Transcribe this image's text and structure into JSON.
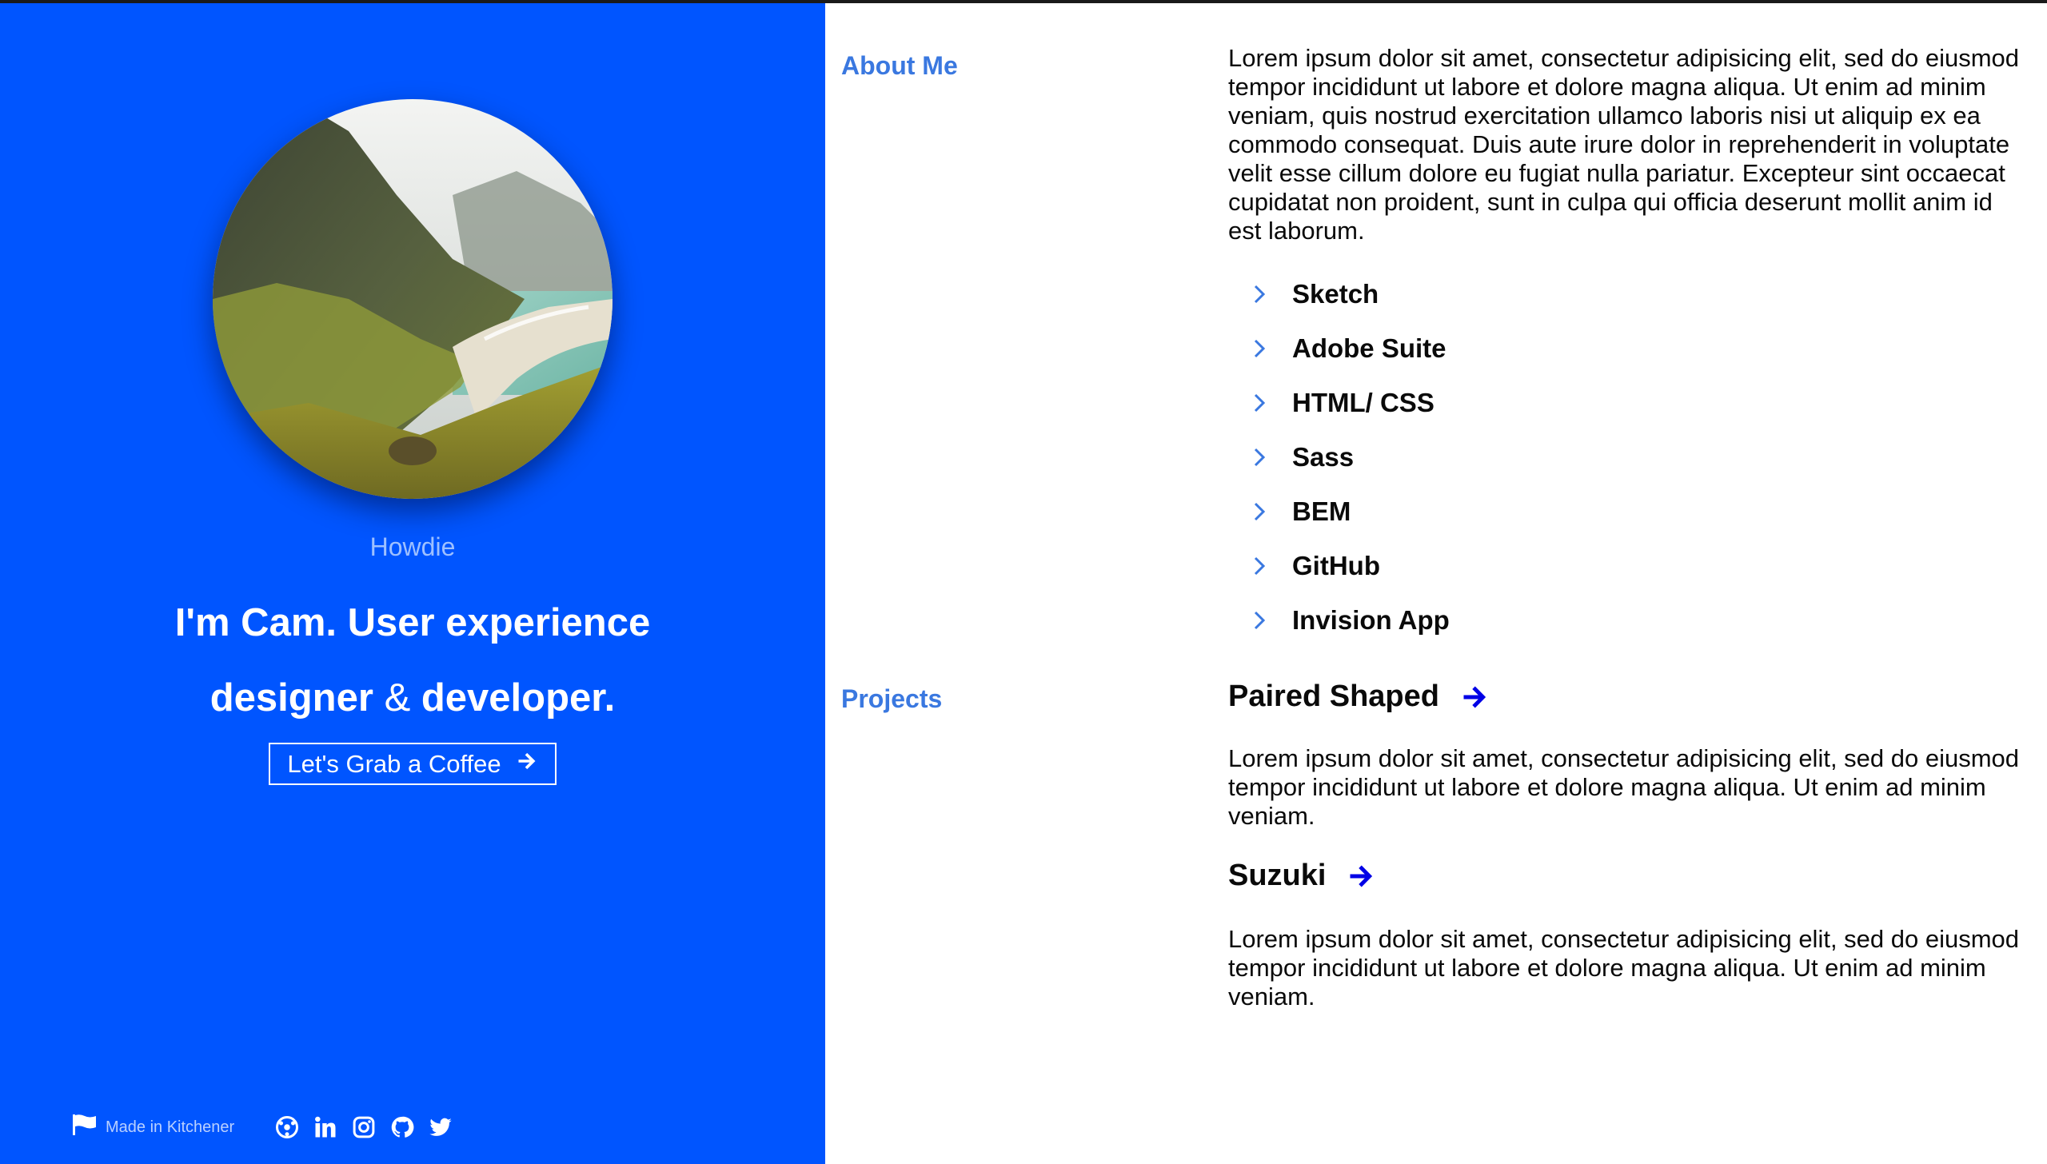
{
  "hero": {
    "greeting": "Howdie",
    "headline_line1": "I'm Cam. User experience",
    "headline_line2_a": "designer",
    "headline_amp": "&",
    "headline_line2_b": "developer.",
    "cta_label": "Let's Grab a Coffee",
    "accent_color": "#0055ff"
  },
  "footer": {
    "made_label": "Made in Kitchener",
    "flag_icon": "flag-icon",
    "socials": [
      "dribbble-icon",
      "linkedin-icon",
      "instagram-icon",
      "github-icon",
      "twitter-icon"
    ]
  },
  "about": {
    "label": "About Me",
    "text": "Lorem ipsum dolor sit amet, consectetur adipisicing elit, sed do eiusmod tempor incididunt ut labore et dolore magna aliqua. Ut enim ad minim veniam, quis nostrud exercitation ullamco laboris nisi ut aliquip ex ea commodo consequat. Duis aute irure dolor in reprehenderit in voluptate velit esse cillum dolore eu fugiat nulla pariatur. Excepteur sint occaecat cupidatat non proident, sunt in culpa qui officia deserunt mollit anim id est laborum.",
    "skills": [
      "Sketch",
      "Adobe Suite",
      "HTML/ CSS",
      "Sass",
      "BEM",
      "GitHub",
      "Invision App"
    ]
  },
  "projects": {
    "label": "Projects",
    "items": [
      {
        "title": "Paired Shaped",
        "description": "Lorem ipsum dolor sit amet, consectetur adipisicing elit, sed do eiusmod tempor incididunt ut labore et dolore magna aliqua. Ut enim ad minim veniam."
      },
      {
        "title": "Suzuki",
        "description": "Lorem ipsum dolor sit amet, consectetur adipisicing elit, sed do eiusmod tempor incididunt ut labore et dolore magna aliqua. Ut enim ad minim veniam."
      }
    ]
  }
}
